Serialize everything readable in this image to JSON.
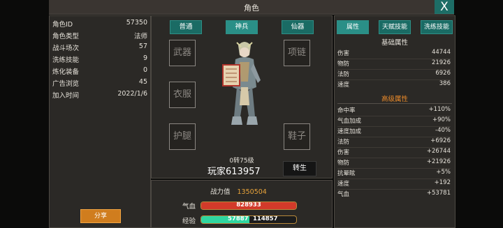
{
  "window": {
    "title": "角色",
    "close_label": "X"
  },
  "info": {
    "rows": [
      {
        "key": "角色ID",
        "value": "57350"
      },
      {
        "key": "角色类型",
        "value": "法师"
      },
      {
        "key": "战斗场次",
        "value": "57"
      },
      {
        "key": "洗练技能",
        "value": "9"
      },
      {
        "key": "炼化装备",
        "value": "0"
      },
      {
        "key": "广告浏览",
        "value": "45"
      },
      {
        "key": "加入时间",
        "value": "2022/1/6"
      }
    ],
    "share_label": "分享"
  },
  "equip": {
    "tabs": [
      {
        "label": "普通",
        "active": false
      },
      {
        "label": "神兵",
        "active": true
      },
      {
        "label": "仙器",
        "active": false
      }
    ],
    "slots": {
      "weapon": "武器",
      "armor": "衣服",
      "leg": "护腿",
      "necklace": "项链",
      "shoes": "鞋子"
    },
    "level": "0转75级",
    "player_name": "玩家613957",
    "rebirth_label": "转生"
  },
  "status": {
    "power_label": "战力值",
    "power_value": "1350504",
    "hp_label": "气血",
    "hp_value": "828933",
    "hp_fill": 1.0,
    "exp_label": "经验",
    "exp_current": "57887",
    "exp_max": "114857",
    "exp_fill": 0.504
  },
  "stats": {
    "tabs": [
      {
        "label": "属性",
        "active": true
      },
      {
        "label": "天赋技能",
        "active": false
      },
      {
        "label": "洗练技能",
        "active": false
      }
    ],
    "basic_title": "基础属性",
    "basic": [
      {
        "key": "伤害",
        "value": "44744"
      },
      {
        "key": "物防",
        "value": "21926"
      },
      {
        "key": "法防",
        "value": "6926"
      },
      {
        "key": "速度",
        "value": "386"
      }
    ],
    "advanced_title": "高级属性",
    "advanced": [
      {
        "key": "命中率",
        "value": "+110%"
      },
      {
        "key": "气血加成",
        "value": "+90%"
      },
      {
        "key": "速度加成",
        "value": "-40%"
      },
      {
        "key": "法防",
        "value": "+6926"
      },
      {
        "key": "伤害",
        "value": "+26744"
      },
      {
        "key": "物防",
        "value": "+21926"
      },
      {
        "key": "抗晕眩",
        "value": "+5%"
      },
      {
        "key": "速度",
        "value": "+192"
      },
      {
        "key": "气血",
        "value": "+53781"
      }
    ]
  },
  "colors": {
    "accent": "#1a6b64",
    "hp": "#d23a2a",
    "exp": "#2fd6a0",
    "advanced_title": "#e8892a",
    "power": "#e8a33a"
  }
}
